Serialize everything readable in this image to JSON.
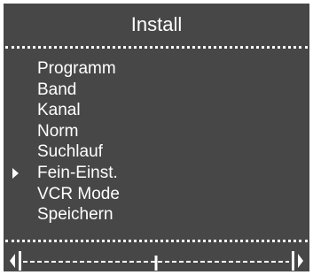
{
  "window": {
    "title": "Install"
  },
  "menu": {
    "items": [
      {
        "label": "Programm",
        "selected": false
      },
      {
        "label": "Band",
        "selected": false
      },
      {
        "label": "Kanal",
        "selected": false
      },
      {
        "label": "Norm",
        "selected": false
      },
      {
        "label": "Suchlauf",
        "selected": false
      },
      {
        "label": "Fein-Einst.",
        "selected": true
      },
      {
        "label": "VCR Mode",
        "selected": false
      },
      {
        "label": "Speichern",
        "selected": false
      }
    ]
  },
  "fine_tuning": {
    "value": 0.5,
    "left_icon": "arrow-left-icon",
    "right_icon": "arrow-right-icon"
  },
  "colors": {
    "background": "#474747",
    "foreground": "#ffffff"
  }
}
